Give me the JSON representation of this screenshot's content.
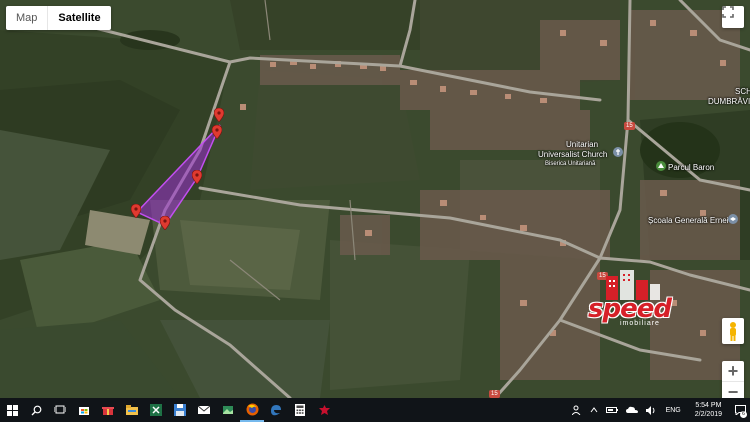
{
  "map": {
    "type_buttons": [
      {
        "label": "Map",
        "active": false
      },
      {
        "label": "Satellite",
        "active": true
      }
    ],
    "labels": {
      "sch": "SCH",
      "dumbravi": "DUMBRĂVI",
      "church_en_1": "Unitarian",
      "church_en_2": "Universalist Church",
      "church_ro": "Biserica Unitariană",
      "park": "Parcul Baron",
      "school": "Școala Generală Ernei"
    },
    "road_numbers": [
      "15",
      "15",
      "15"
    ],
    "zoom_in": "+",
    "zoom_out": "−",
    "polygon_color": "#9b2fd0",
    "marker_color": "#e03a30",
    "icons": [
      "fullscreen-icon",
      "pegman-icon",
      "map-marker-icon",
      "church-icon",
      "school-icon"
    ]
  },
  "logo": {
    "word": "speed",
    "sub": "imobiliare",
    "color": "#d62028"
  },
  "taskbar": {
    "apps": [
      "start-icon",
      "search-icon",
      "task-view-icon",
      "store-icon",
      "gift-icon",
      "file-explorer-icon",
      "excel-icon",
      "floppy-icon",
      "mail-icon",
      "photos-icon",
      "firefox-icon",
      "edge-icon",
      "calculator-icon",
      "game-icon"
    ],
    "language": "ENG",
    "time": "5:54 PM",
    "date": "2/2/2019",
    "notifications": "6"
  }
}
